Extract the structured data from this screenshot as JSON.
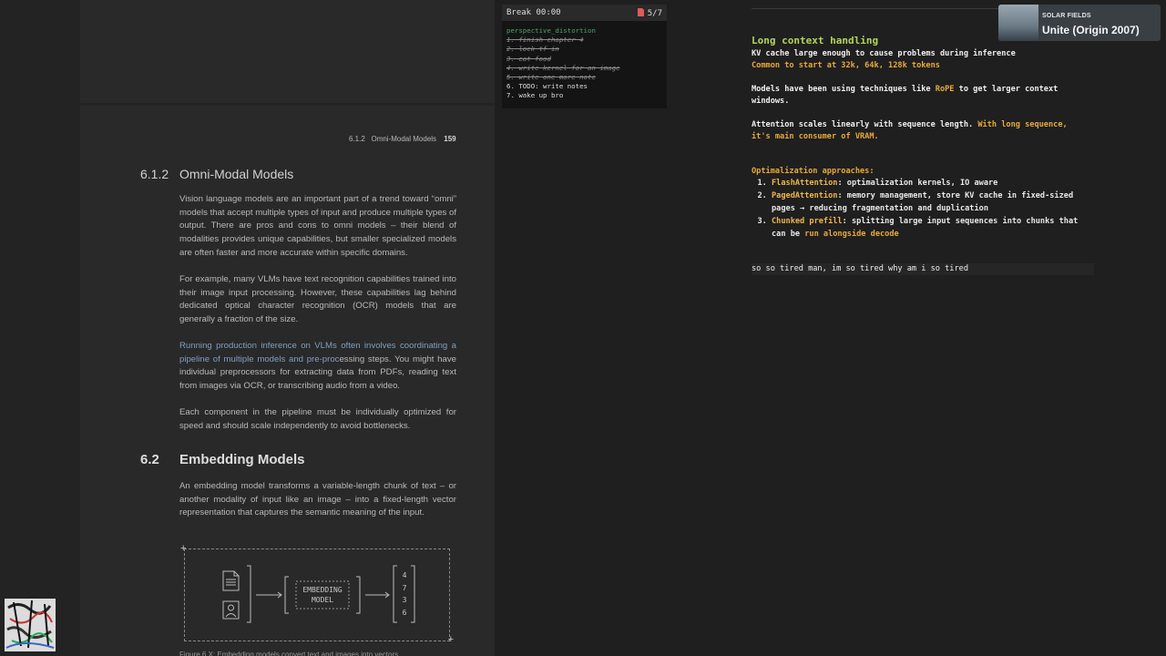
{
  "pdf": {
    "running_header": {
      "section": "6.1.2",
      "title": "Omni-Modal Models",
      "page": "159"
    },
    "section_612": {
      "number": "6.1.2",
      "title": "Omni-Modal Models"
    },
    "paragraphs": [
      "Vision language models are an important part of a trend toward “omni” models that accept multiple types of input and produce multiple types of output. There are pros and cons to omni models – their blend of modalities provides unique capabilities, but smaller specialized models are often faster and more accurate within specific domains.",
      "For example, many VLMs have text recognition capabilities trained into their image input processing. However, these capabilities lag behind dedicated optical character recognition (OCR) models that are generally a fraction of the size.",
      "Each component in the pipeline must be individually optimized for speed and should scale independently to avoid bottlenecks."
    ],
    "para3_highlight": "Running production inference on VLMs often involves coordinating a pipeline of multiple models and pre-proc",
    "para3_rest": "essing steps. You might have individual preprocessors for extracting data from PDFs, reading text from images via OCR, or transcribing audio from a video.",
    "section_62": {
      "number": "6.2",
      "title": "Embedding Models"
    },
    "para_62": "An embedding model transforms a variable-length chunk of text – or another modality of input like an image – into a fixed-length vector representation that captures the semantic meaning of the input.",
    "figure": {
      "box_label_line1": "EMBEDDING",
      "box_label_line2": "MODEL",
      "vector": [
        "4",
        "7",
        "3",
        "6"
      ],
      "input_icons": [
        "document-icon",
        "user-icon"
      ]
    },
    "caption_partial": "Figure 6.X: Embedding models convert text and images into vectors"
  },
  "todo": {
    "timer_label": "Break 00:00",
    "page_count": "5/7",
    "list_title": "perspective_distortion",
    "items": [
      {
        "text": "1. finish chapter 4",
        "done": true
      },
      {
        "text": "2. lock tf in",
        "done": true
      },
      {
        "text": "3. eat food",
        "done": true
      },
      {
        "text": "4. write kernel for an image",
        "done": true
      },
      {
        "text": "5. write one more note",
        "done": true
      },
      {
        "text": "6. TODO: write notes",
        "done": false
      },
      {
        "text": "7. wake up bro",
        "done": false
      }
    ]
  },
  "notes": {
    "heading": "Long context handling",
    "line1": "KV cache large enough to cause problems during inference",
    "line2": "Common to start at 32k, 64k, 128k tokens",
    "line3a": "Models have been using techniques like ",
    "line3_kw": "RoPE",
    "line3b": " to get larger context",
    "line3c": "windows.",
    "line4a": "Attention scales linearly with sequence length. ",
    "line4_or": "With long sequence,",
    "line4c": "it's main consumer of VRAM.",
    "approaches_title": "Optimalization approaches:",
    "approaches": [
      {
        "kw": "FlashAttention",
        "text": ": optimalization kernels, IO aware",
        "text2": ""
      },
      {
        "kw": "PagedAttention",
        "text": ": memory management, store KV cache in fixed-sized",
        "text2": "pages → reducing fragmentation and duplication"
      },
      {
        "kw": "Chunked prefill",
        "text": ": splitting large input sequences into chunks that",
        "text2": "can be ",
        "text2_kw": "run alongside decode"
      }
    ],
    "tired": "so so tired man, im so tired why am i so tired"
  },
  "music": {
    "artist": "SOLAR FIELDS",
    "title": "Unite (Origin 2007)"
  },
  "colors": {
    "heading_green": "#b3d45a",
    "accent_orange": "#e8a93c",
    "link_blue": "#7f9fc3"
  }
}
